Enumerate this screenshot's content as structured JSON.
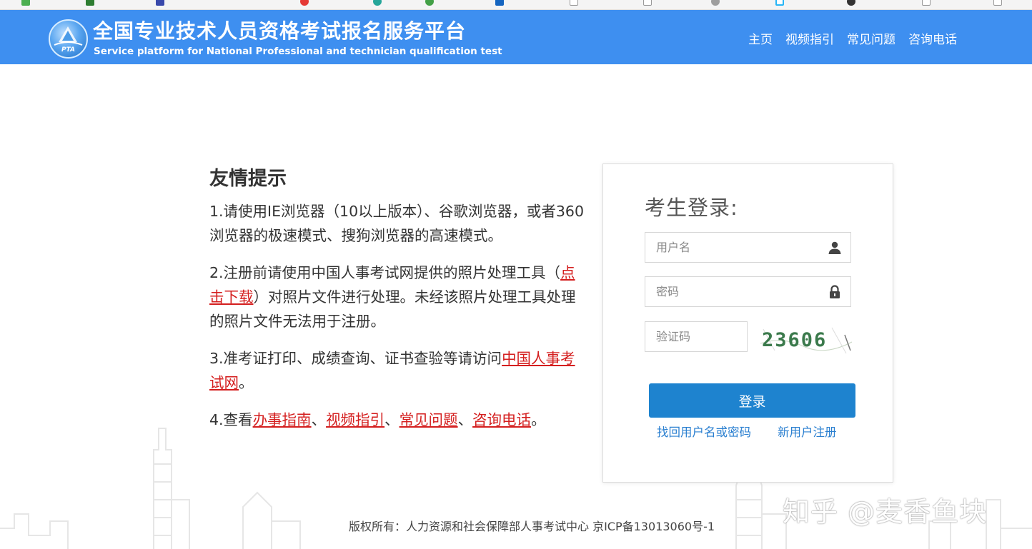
{
  "header": {
    "title": "全国专业技术人员资格考试报名服务平台",
    "subtitle": "Service platform for National Professional and technician qualification test",
    "logo_text": "PTA",
    "nav": [
      "主页",
      "视频指引",
      "常见问题",
      "咨询电话"
    ]
  },
  "tips": {
    "heading": "友情提示",
    "tip1": "1.请使用IE浏览器（10以上版本）、谷歌浏览器，或者360浏览器的极速模式、搜狗浏览器的高速模式。",
    "tip2_pre": "2.注册前请使用中国人事考试网提供的照片处理工具（",
    "tip2_link": "点击下载",
    "tip2_post": "）对照片文件进行处理。未经该照片处理工具处理的照片文件无法用于注册。",
    "tip3_pre": "3.准考证打印、成绩查询、证书查验等请访问",
    "tip3_link": "中国人事考试网",
    "tip3_post": "。",
    "tip4_pre": "4.查看",
    "tip4_links": [
      "办事指南",
      "视频指引",
      "常见问题",
      "咨询电话"
    ],
    "tip4_sep": "、",
    "tip4_post": "。"
  },
  "login": {
    "title": "考生登录:",
    "username_placeholder": "用户名",
    "password_placeholder": "密码",
    "captcha_placeholder": "验证码",
    "captcha_text": "23606",
    "submit_label": "登录",
    "recover_link": "找回用户名或密码",
    "register_link": "新用户注册"
  },
  "footer": {
    "copyright": "版权所有：人力资源和社会保障部人事考试中心 京ICP备13013060号-1"
  },
  "watermark": "知乎 @麦香鱼块",
  "colors": {
    "header_bg": "#3e8ff0",
    "button_bg": "#1e83cf",
    "link_red": "#d41e1e",
    "link_blue": "#2a7fd0"
  }
}
